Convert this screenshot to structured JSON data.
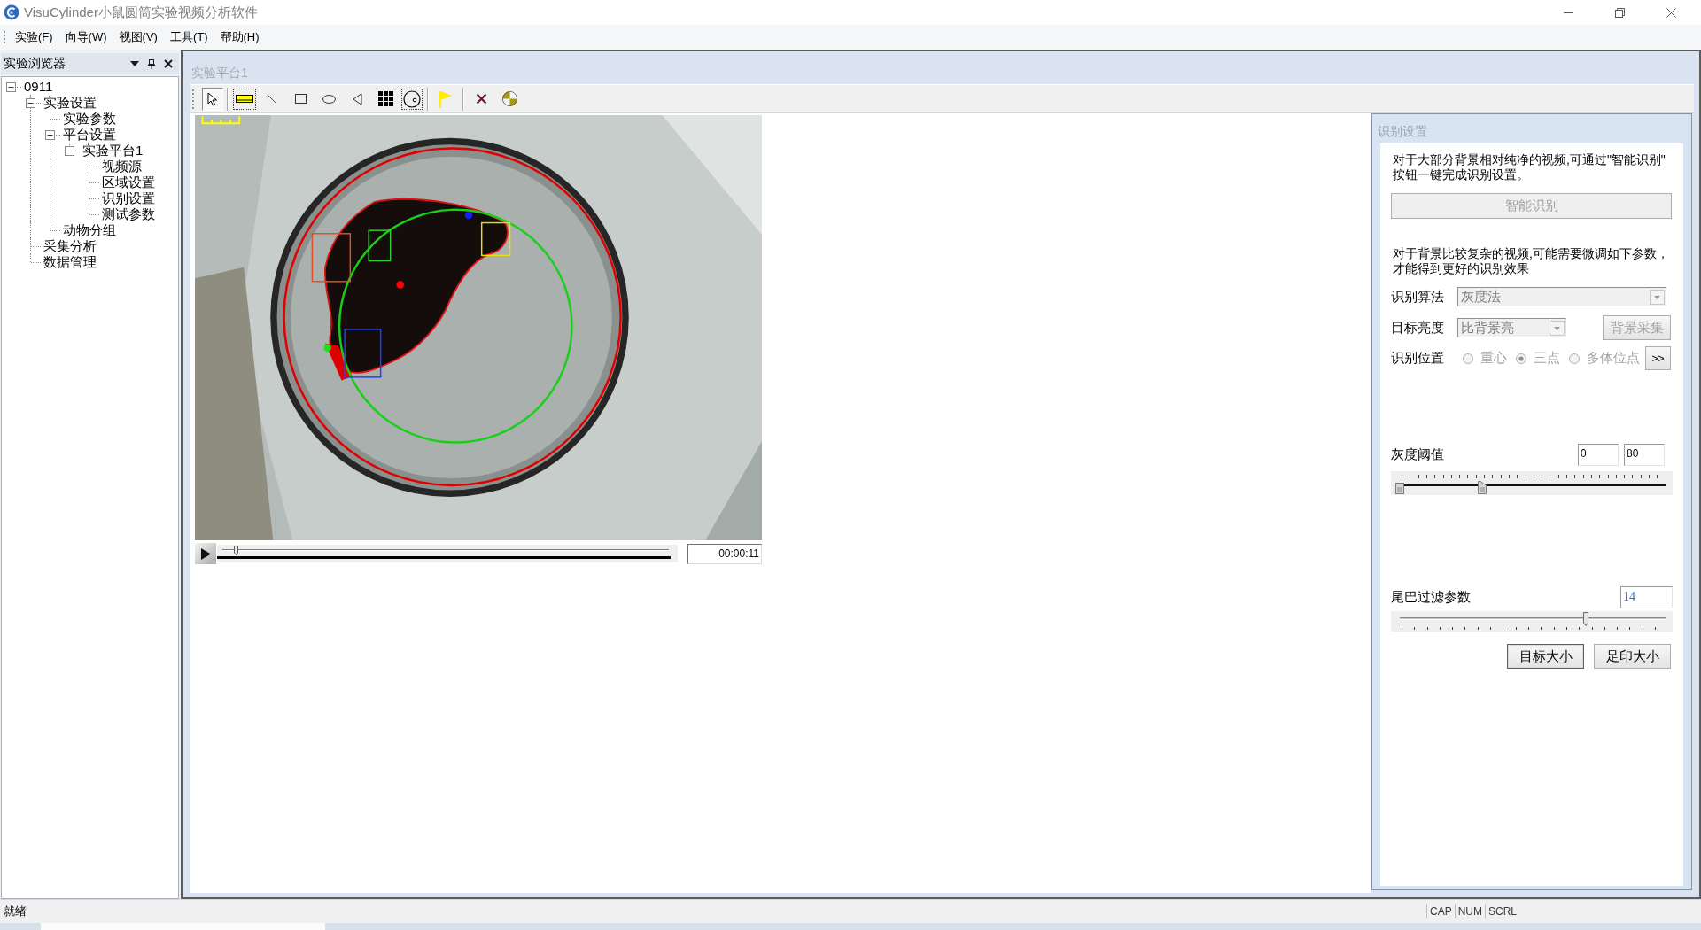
{
  "window": {
    "title": "VisuCylinder小鼠圆筒实验视频分析软件"
  },
  "menu": [
    "实验(F)",
    "向导(W)",
    "视图(V)",
    "工具(T)",
    "帮助(H)"
  ],
  "explorer": {
    "title": "实验浏览器",
    "nodes": [
      {
        "label": "0911",
        "expanded": true,
        "children": [
          {
            "label": "实验设置",
            "expanded": true,
            "children": [
              {
                "label": "实验参数"
              },
              {
                "label": "平台设置",
                "expanded": true,
                "children": [
                  {
                    "label": "实验平台1",
                    "expanded": true,
                    "children": [
                      {
                        "label": "视频源"
                      },
                      {
                        "label": "区域设置"
                      },
                      {
                        "label": "识别设置"
                      },
                      {
                        "label": "测试参数"
                      }
                    ]
                  }
                ]
              },
              {
                "label": "动物分组"
              }
            ]
          },
          {
            "label": "采集分析"
          },
          {
            "label": "数据管理"
          }
        ]
      }
    ]
  },
  "document": {
    "title": "实验平台1"
  },
  "toolbar": {
    "groups": [
      [
        {
          "selected": true,
          "highlighted": false
        }
      ],
      [
        {
          "selected": false,
          "highlighted": true
        },
        {
          "selected": false,
          "highlighted": false
        },
        {
          "selected": false,
          "highlighted": false
        },
        {
          "selected": false,
          "highlighted": false
        },
        {
          "selected": false,
          "highlighted": false
        },
        {
          "selected": false,
          "highlighted": false
        },
        {
          "selected": false,
          "highlighted": true
        }
      ],
      [
        {
          "selected": false,
          "highlighted": false
        }
      ],
      [
        {
          "selected": false,
          "highlighted": false
        },
        {
          "selected": false,
          "highlighted": false
        }
      ]
    ]
  },
  "player": {
    "level": 0.03,
    "time": "00:00:11"
  },
  "recognition": {
    "title": "识别设置",
    "intro": [
      "对于大部分背景相对纯净的视频,可通过\"智能识别\"",
      "按钮一键完成识别设置。"
    ],
    "smart_button": {
      "label": "智能识别",
      "disabled": true
    },
    "advice": [
      "对于背景比较复杂的视频,可能需要微调如下参数，",
      "才能得到更好的识别效果"
    ],
    "algorithm": {
      "label": "识别算法",
      "value": "灰度法",
      "disabled": true
    },
    "brightness": {
      "label": "目标亮度",
      "value": "比背景亮",
      "disabled": true
    },
    "background_button": {
      "label": "背景采集",
      "disabled": true
    },
    "position": {
      "label": "识别位置",
      "disabled": true,
      "options": [
        {
          "label": "重心",
          "selected": false
        },
        {
          "label": "三点",
          "selected": true
        },
        {
          "label": "多体位点",
          "selected": false
        }
      ]
    },
    "more_button": {
      "label": ">>",
      "disabled": false
    },
    "gray_threshold": {
      "label": "灰度阈值",
      "low": {
        "value": "0",
        "level": 0
      },
      "high": {
        "value": "80",
        "level": 0.31
      }
    },
    "tail_filter": {
      "label": "尾巴过滤参数",
      "value": "14",
      "level": 0.7
    },
    "buttons": [
      {
        "label": "目标大小",
        "disabled": false
      },
      {
        "label": "足印大小",
        "disabled": false
      }
    ]
  },
  "status_bar": {
    "text": "就绪",
    "indicators": [
      "CAP",
      "NUM",
      "SCRL"
    ]
  }
}
